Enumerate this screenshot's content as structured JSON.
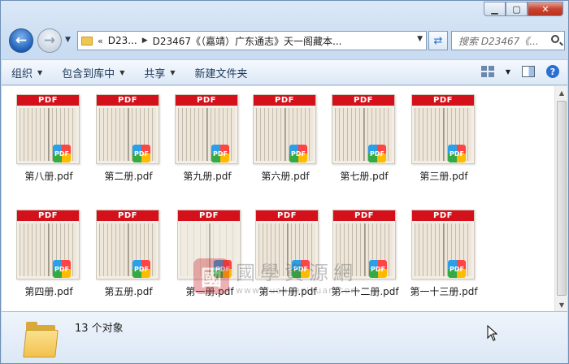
{
  "window": {
    "caption_buttons": [
      "minimize",
      "maximize",
      "close"
    ]
  },
  "nav": {
    "address_chevrons": "«",
    "address_segment_1": "D23...",
    "address_segment_2": "D23467《（嘉靖）广东通志》天一阁藏本...",
    "search_placeholder": "搜索 D23467《...",
    "back_icon": "arrow-left-icon",
    "forward_icon": "arrow-right-icon"
  },
  "toolbar": {
    "organize": "组织",
    "include_in_library": "包含到库中",
    "share": "共享",
    "new_folder": "新建文件夹"
  },
  "thumb_label": "PDF",
  "badge_label": "PDF",
  "files": [
    {
      "name": "第八册.pdf"
    },
    {
      "name": "第二册.pdf"
    },
    {
      "name": "第九册.pdf"
    },
    {
      "name": "第六册.pdf"
    },
    {
      "name": "第七册.pdf"
    },
    {
      "name": "第三册.pdf"
    },
    {
      "name": "第四册.pdf"
    },
    {
      "name": "第五册.pdf"
    },
    {
      "name": "第一册.pdf"
    },
    {
      "name": "第一十册.pdf"
    },
    {
      "name": "第一十二册.pdf"
    },
    {
      "name": "第一十三册.pdf"
    }
  ],
  "watermark": {
    "seal": "國",
    "chinese": "國學資源網",
    "url": "www.guoxueziyuan.com"
  },
  "details": {
    "count": "13 个对象"
  },
  "colors": {
    "pdf_band": "#d4111b",
    "window_frame": "#c9dcf1",
    "toolbar": "#dce8f6"
  }
}
